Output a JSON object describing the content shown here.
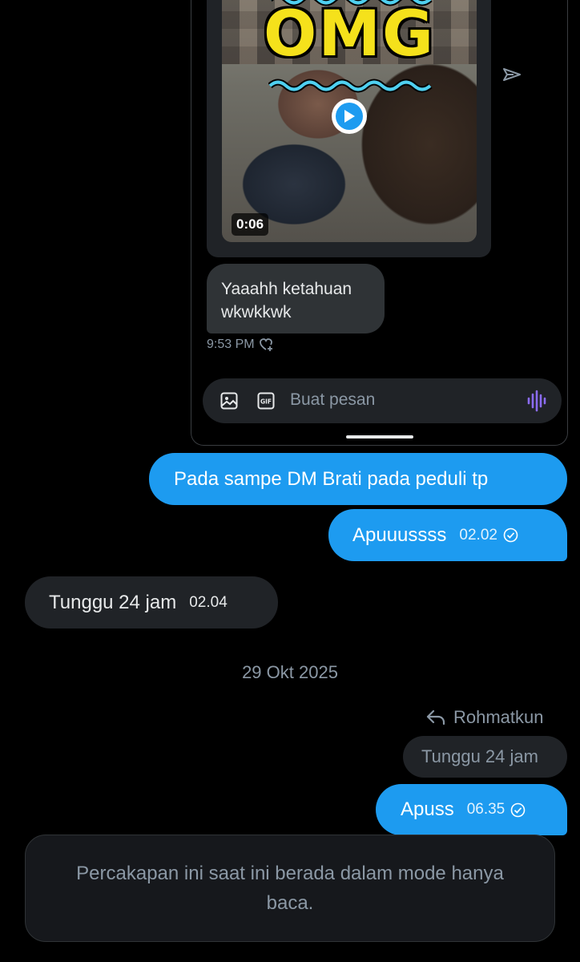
{
  "embedded_screenshot": {
    "video_overlay_text": "OMG",
    "video_duration": "0:06",
    "received_message": "Yaaahh ketahuan wkwkkwk",
    "received_time": "9:53 PM",
    "composer_placeholder": "Buat pesan",
    "gif_label": "GIF",
    "icons": [
      "image-icon",
      "gif-icon",
      "voice-icon",
      "play-icon",
      "forward-icon",
      "react-heart-icon"
    ]
  },
  "messages": [
    {
      "id": "m1",
      "direction": "sent",
      "text": "Pada sampe DM Brati pada peduli tp",
      "time": ""
    },
    {
      "id": "m2",
      "direction": "sent",
      "text": "Apuuussss",
      "time": "02.02",
      "status": "read"
    },
    {
      "id": "m3",
      "direction": "received",
      "text": "Tunggu 24 jam",
      "time": "02.04"
    }
  ],
  "date_separator": "29 Okt 2025",
  "reply": {
    "replying_to": "Rohmatkun",
    "quoted_text": "Tunggu 24 jam",
    "message": {
      "direction": "sent",
      "text": "Apuss",
      "time": "06.35",
      "status": "read"
    }
  },
  "readonly_notice": "Percakapan ini saat ini berada dalam mode hanya baca.",
  "colors": {
    "background": "#000000",
    "sent_bubble": "#1d9bf0",
    "received_bubble": "#202327",
    "muted_text": "#8b98a5",
    "overlay_text": "#f5e11b"
  }
}
